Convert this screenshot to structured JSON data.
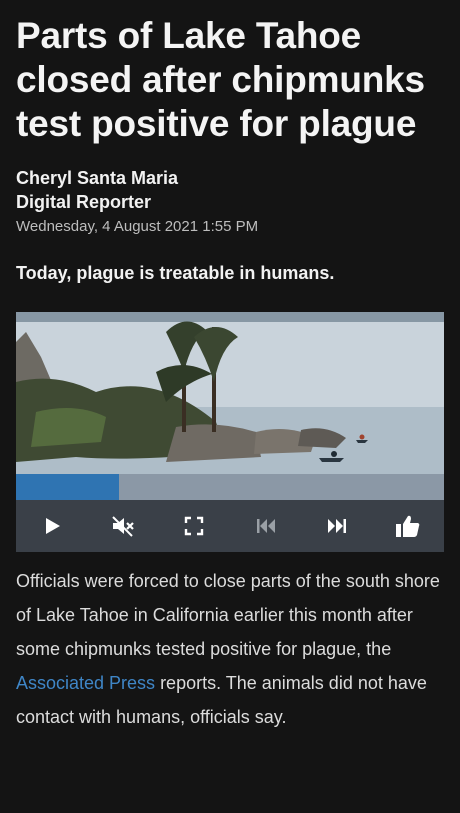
{
  "article": {
    "headline": "Parts of Lake Tahoe closed after chipmunks test positive for plague",
    "author": "Cheryl Santa Maria",
    "author_role": "Digital Reporter",
    "date": "Wednesday, 4 August 2021 1:55 PM",
    "lede": "Today, plague is treatable in humans.",
    "body_before_link": "Officials were forced to close parts of the south shore of Lake Tahoe in California earlier this month after some chipmunks tested positive for plague, the ",
    "link_text": "Associated Press",
    "body_after_link": " reports. The animals did not have contact with humans, officials say."
  },
  "video": {
    "progress": 0.24,
    "controls": [
      "play-icon",
      "mute-icon",
      "fullscreen-icon",
      "previous-icon",
      "next-icon",
      "thumbs-up-icon"
    ]
  },
  "colors": {
    "background": "#141414",
    "link": "#3f86c7",
    "progress_fill": "#2f74b2",
    "progress_track": "#8b98a6",
    "controls_bar": "#3a4048"
  }
}
